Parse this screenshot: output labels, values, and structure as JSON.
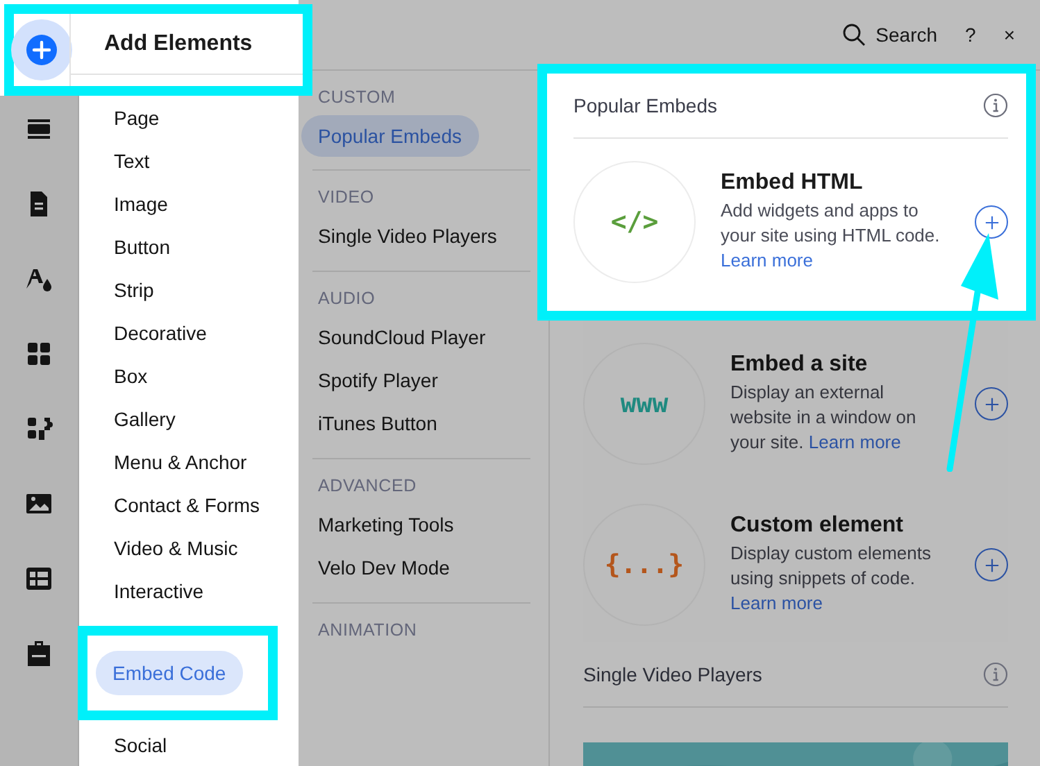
{
  "rail": {
    "items": [
      {
        "selected": true
      },
      {
        "selected": false
      },
      {
        "selected": false
      },
      {
        "selected": false
      },
      {
        "selected": false
      },
      {
        "selected": false
      },
      {
        "selected": false
      },
      {
        "selected": false
      },
      {
        "selected": false
      }
    ]
  },
  "header": {
    "title": "Add Elements",
    "spotlight": true
  },
  "categories": [
    {
      "label": "Page",
      "selected": false,
      "spotlight": false
    },
    {
      "label": "Text",
      "selected": false,
      "spotlight": false
    },
    {
      "label": "Image",
      "selected": false,
      "spotlight": false
    },
    {
      "label": "Button",
      "selected": false,
      "spotlight": false
    },
    {
      "label": "Strip",
      "selected": false,
      "spotlight": false
    },
    {
      "label": "Decorative",
      "selected": false,
      "spotlight": false
    },
    {
      "label": "Box",
      "selected": false,
      "spotlight": false
    },
    {
      "label": "Gallery",
      "selected": false,
      "spotlight": false
    },
    {
      "label": "Menu & Anchor",
      "selected": false,
      "spotlight": false
    },
    {
      "label": "Contact & Forms",
      "selected": false,
      "spotlight": false
    },
    {
      "label": "Video & Music",
      "selected": false,
      "spotlight": false
    },
    {
      "label": "Interactive",
      "selected": false,
      "spotlight": false
    },
    {
      "label": "Embed Code",
      "selected": true,
      "spotlight": true
    },
    {
      "label": "Social",
      "selected": false,
      "spotlight": false
    }
  ],
  "subcategories": [
    {
      "heading": "CUSTOM",
      "items": [
        {
          "label": "Popular Embeds",
          "selected": true
        }
      ]
    },
    {
      "heading": "VIDEO",
      "items": [
        {
          "label": "Single Video Players",
          "selected": false
        }
      ]
    },
    {
      "heading": "AUDIO",
      "items": [
        {
          "label": "SoundCloud Player",
          "selected": false
        },
        {
          "label": "Spotify Player",
          "selected": false
        },
        {
          "label": "iTunes Button",
          "selected": false
        }
      ]
    },
    {
      "heading": "ADVANCED",
      "items": [
        {
          "label": "Marketing Tools",
          "selected": false
        },
        {
          "label": "Velo Dev Mode",
          "selected": false
        }
      ]
    },
    {
      "heading": "ANIMATION"
    }
  ],
  "top_bar": {
    "search": "Search",
    "help": "?",
    "close": "×"
  },
  "sections": [
    {
      "title": "Popular Embeds",
      "spotlight": true,
      "items": [
        {
          "glyph": "</>",
          "color": "#5a9e3c",
          "title": "Embed HTML",
          "description": "Add widgets and apps to your site using HTML code.",
          "link": "Learn more",
          "spotlight": true
        },
        {
          "glyph": "www",
          "color": "#1f8a80",
          "title": "Embed a site",
          "description": "Display an external website in a window on your site.",
          "link": "Learn more",
          "spotlight": false
        },
        {
          "glyph": "{...}",
          "color": "#b4561c",
          "title": "Custom element",
          "description": "Display custom elements using snippets of code.",
          "link": "Learn more",
          "spotlight": false
        }
      ]
    },
    {
      "title": "Single Video Players",
      "spotlight": false,
      "kind": "picture"
    }
  ]
}
